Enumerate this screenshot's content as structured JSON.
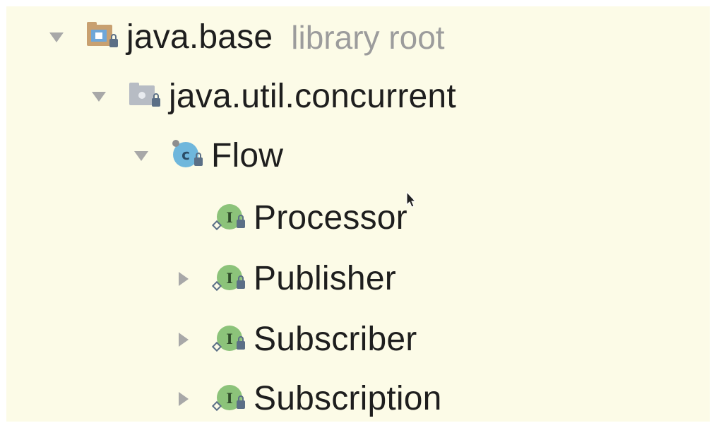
{
  "tree": {
    "root": {
      "label": "java.base",
      "sublabel": "library root",
      "expanded": true,
      "icon": "module-folder-icon"
    },
    "package": {
      "label": "java.util.concurrent",
      "expanded": true,
      "icon": "package-icon"
    },
    "class": {
      "label": "Flow",
      "expanded": true,
      "icon": "class-icon"
    },
    "children": [
      {
        "label": "Processor",
        "expandable": false,
        "icon": "interface-icon"
      },
      {
        "label": "Publisher",
        "expandable": true,
        "expanded": false,
        "icon": "interface-icon"
      },
      {
        "label": "Subscriber",
        "expandable": true,
        "expanded": false,
        "icon": "interface-icon"
      },
      {
        "label": "Subscription",
        "expandable": true,
        "expanded": false,
        "icon": "interface-icon"
      }
    ]
  },
  "colors": {
    "background": "#fcfbe7",
    "text": "#1e1e1e",
    "sublabel": "#9c9c9c",
    "arrow": "#a8a8a8",
    "interface_green": "#8cc37a",
    "class_blue": "#6fb7dc",
    "folder_brown": "#c8a070"
  }
}
